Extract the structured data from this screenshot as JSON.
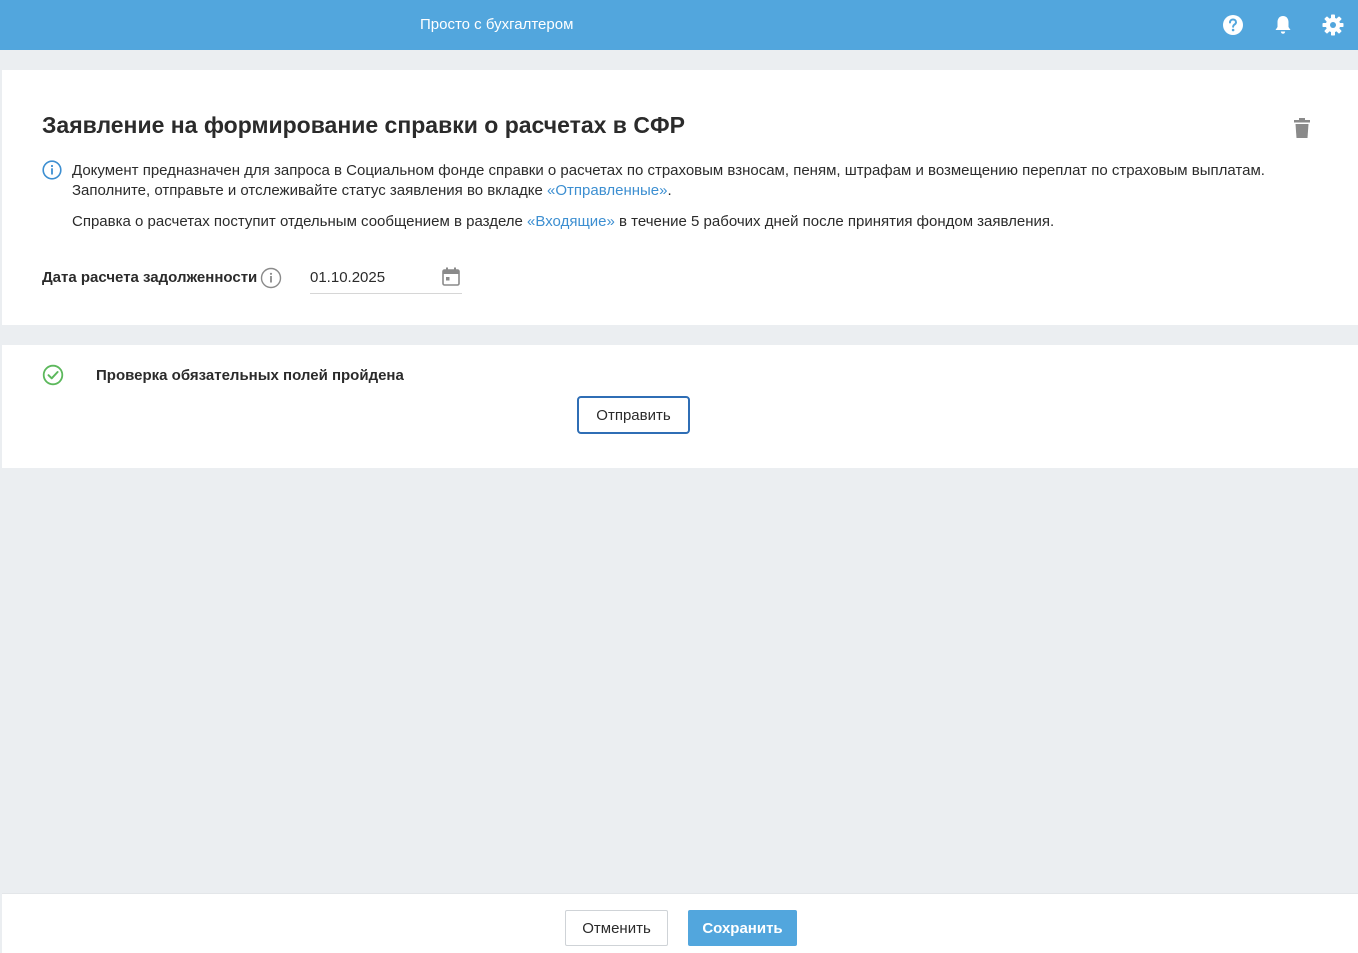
{
  "header": {
    "title": "Просто с бухгалтером",
    "help_icon": "question-circle-icon",
    "notifications_icon": "bell-icon",
    "settings_icon": "gear-icon",
    "background": "#52a6dd"
  },
  "form": {
    "title": "Заявление на формирование справки о расчетах в СФР",
    "description": {
      "text": "Документ предназначен для запроса в Социальном фонде справки о расчетах по страховым взносам, пеням, штрафам и возмещению переплат по страховым выплатам. Заполните, отправьте и отслеживайте статус заявления во вкладке ",
      "link": "«Отправленные»",
      "suffix": "."
    },
    "note": {
      "prefix": "Справка о расчетах поступит отдельным сообщением в разделе ",
      "link": "«Входящие»",
      "suffix": " в течение 5 рабочих дней после принятия фондом заявления."
    },
    "date_field": {
      "label": "Дата расчета задолженности",
      "value": "01.10.2025"
    }
  },
  "validation": {
    "status_text": "Проверка обязательных полей пройдена",
    "send_label": "Отправить"
  },
  "footer": {
    "cancel_label": "Отменить",
    "save_label": "Сохранить"
  },
  "colors": {
    "accent": "#52a6dd",
    "link": "#3d8fd1",
    "success": "#5cb85c",
    "icon_gray": "#8a8a8a"
  }
}
